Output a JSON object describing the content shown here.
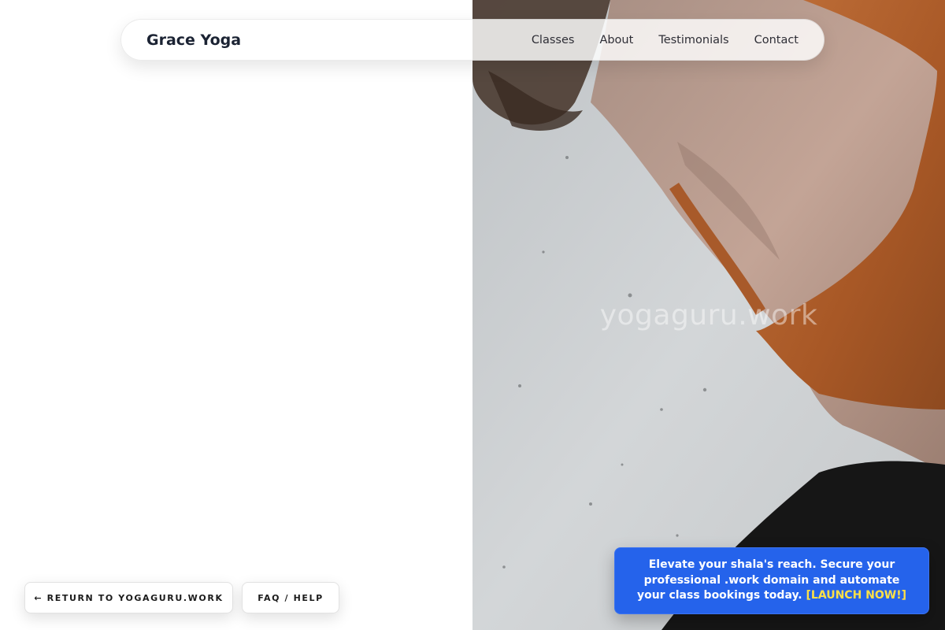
{
  "navbar": {
    "brand": "Grace Yoga",
    "links": [
      "Classes",
      "About",
      "Testimonials",
      "Contact"
    ]
  },
  "hero": {
    "watermark": "yogaguru.work",
    "image_description_icon": "hero-photo"
  },
  "footer": {
    "return_label": "← RETURN TO YOGAGURU.WORK",
    "faq_label": "FAQ / HELP"
  },
  "promo": {
    "text": "Elevate your shala's reach. Secure your professional .work domain and automate your class bookings today.",
    "cta": "[LAUNCH NOW!]"
  },
  "colors": {
    "promo_bg": "#2563eb",
    "promo_cta": "#fde047",
    "brand_text": "#1b2333",
    "top_color": "#b5642c"
  }
}
